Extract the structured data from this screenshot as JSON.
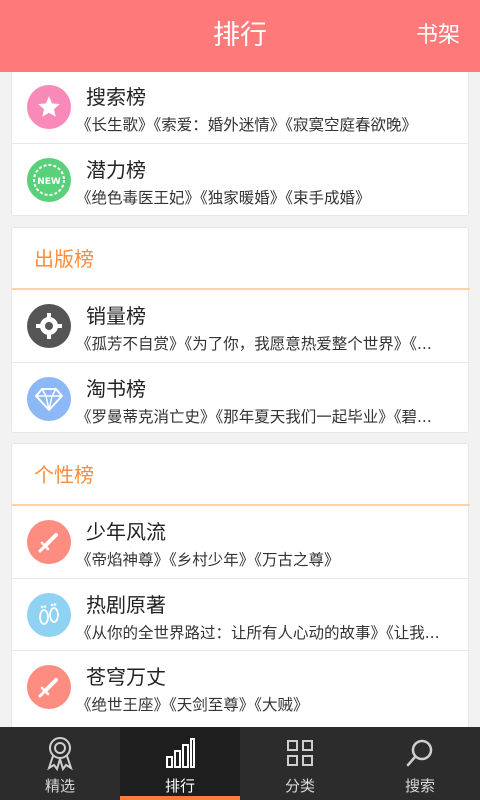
{
  "header": {
    "title": "排行",
    "right_label": "书架"
  },
  "card1": {
    "items": [
      {
        "title": "搜索榜",
        "desc": "《长生歌》《索爱：婚外迷情》《寂寞空庭春欲晚》",
        "icon": "star-icon",
        "color": "#f989b9"
      },
      {
        "title": "潜力榜",
        "desc": "《绝色毒医王妃》《独家暖婚》《束手成婚》",
        "icon": "new-badge-icon",
        "color": "#59d07a",
        "badge_text": "NEW"
      }
    ]
  },
  "publish": {
    "title": "出版榜",
    "items": [
      {
        "title": "销量榜",
        "desc": "《孤芳不自赏》《为了你，我愿意热爱整个世界》《...",
        "icon": "gear-icon",
        "color": "#555555"
      },
      {
        "title": "淘书榜",
        "desc": "《罗曼蒂克消亡史》《那年夏天我们一起毕业》《碧...",
        "icon": "diamond-icon",
        "color": "#8cb8f5"
      }
    ]
  },
  "personal": {
    "title": "个性榜",
    "items": [
      {
        "title": "少年风流",
        "desc": "《帝焰神尊》《乡村少年》《万古之尊》",
        "icon": "sword-icon",
        "color": "#fd8d80"
      },
      {
        "title": "热剧原著",
        "desc": "《从你的全世界路过：让所有人心动的故事》《让我...",
        "icon": "footprints-icon",
        "color": "#8fd2f2"
      },
      {
        "title": "苍穹万丈",
        "desc": "《绝世王座》《天剑至尊》《大贼》",
        "icon": "sword-icon",
        "color": "#fd8d80"
      }
    ]
  },
  "tabbar": {
    "tabs": [
      {
        "label": "精选",
        "icon": "award-icon",
        "active": false
      },
      {
        "label": "排行",
        "icon": "bar-chart-icon",
        "active": true
      },
      {
        "label": "分类",
        "icon": "grid-icon",
        "active": false
      },
      {
        "label": "搜索",
        "icon": "search-icon",
        "active": false
      }
    ]
  },
  "colors": {
    "header": "#fe7979",
    "section_title": "#fb8c3a",
    "tab_active_bar": "#fe7a3e",
    "tabbar_bg": "#2c2c2c"
  }
}
